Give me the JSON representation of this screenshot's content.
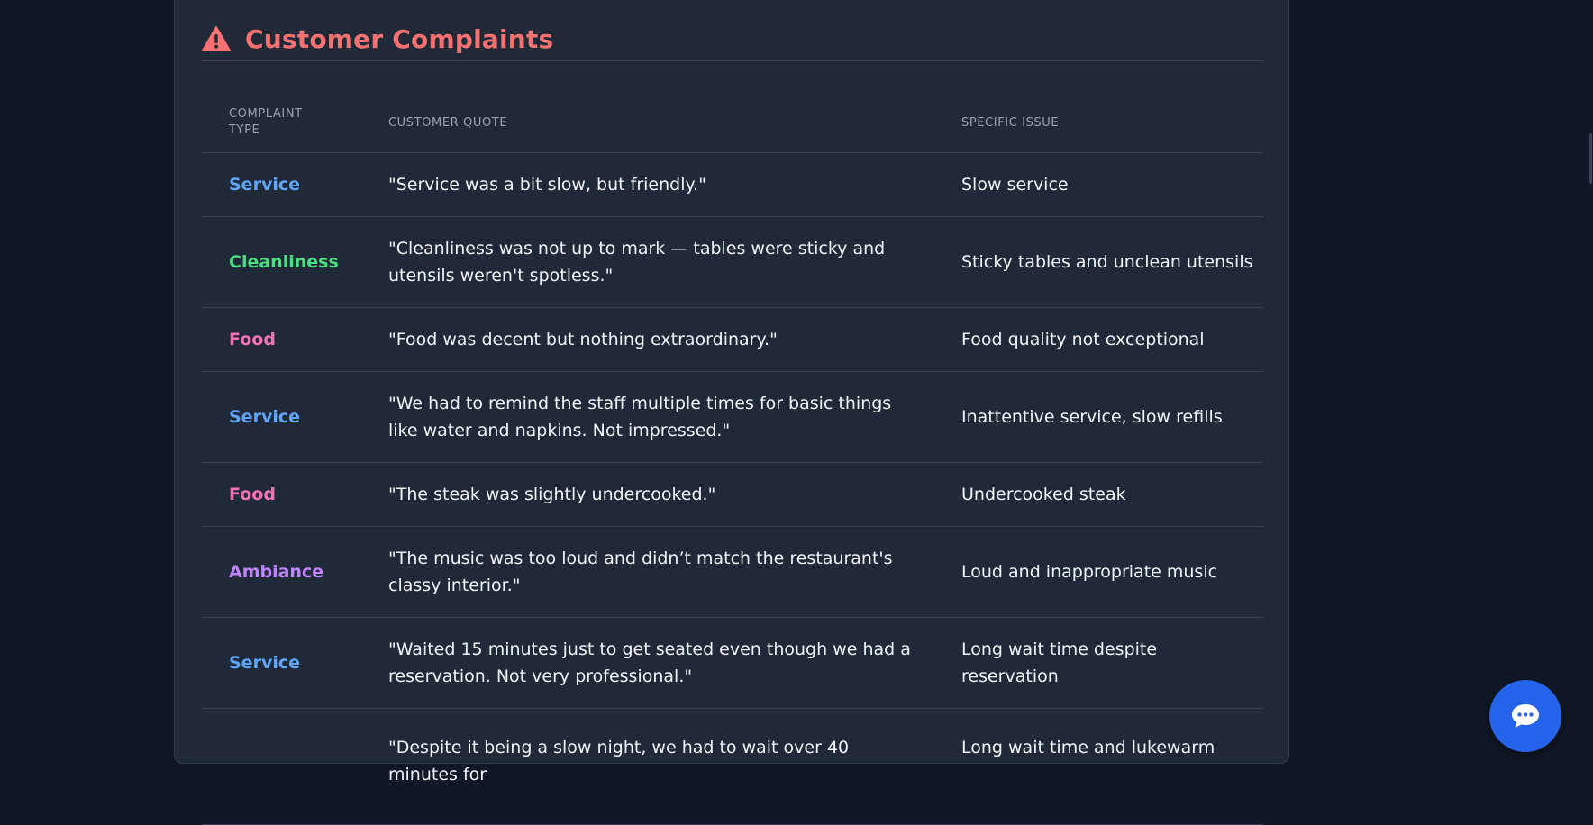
{
  "colors": {
    "title": "#f87171",
    "service": "#60a5fa",
    "cleanliness": "#4ade80",
    "food": "#f472b6",
    "ambiance": "#c084fc",
    "chat_button": "#2563eb"
  },
  "header": {
    "icon": "warning-triangle-icon",
    "title": "Customer Complaints"
  },
  "table": {
    "columns": [
      "Complaint Type",
      "Customer Quote",
      "Specific Issue"
    ],
    "rows": [
      {
        "type": "Service",
        "quote": "\"Service was a bit slow, but friendly.\"",
        "issue": "Slow service"
      },
      {
        "type": "Cleanliness",
        "quote": "\"Cleanliness was not up to mark — tables were sticky and utensils weren't spotless.\"",
        "issue": "Sticky tables and unclean utensils"
      },
      {
        "type": "Food",
        "quote": "\"Food was decent but nothing extraordinary.\"",
        "issue": "Food quality not exceptional"
      },
      {
        "type": "Service",
        "quote": "\"We had to remind the staff multiple times for basic things like water and napkins. Not impressed.\"",
        "issue": "Inattentive service, slow refills"
      },
      {
        "type": "Food",
        "quote": "\"The steak was slightly undercooked.\"",
        "issue": "Undercooked steak"
      },
      {
        "type": "Ambiance",
        "quote": "\"The music was too loud and didn’t match the restaurant's classy interior.\"",
        "issue": "Loud and inappropriate music"
      },
      {
        "type": "Service",
        "quote": "\"Waited 15 minutes just to get seated even though we had a reservation. Not very professional.\"",
        "issue": "Long wait time despite reservation"
      },
      {
        "type": "",
        "quote": "\"Despite it being a slow night, we had to wait over 40 minutes for",
        "issue": "Long wait time and lukewarm"
      }
    ]
  },
  "chat_button": {
    "icon": "chat-bubble-icon"
  }
}
